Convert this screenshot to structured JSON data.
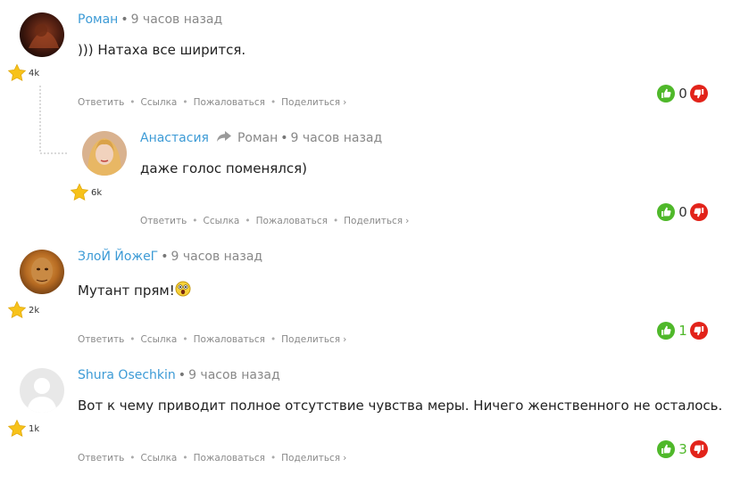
{
  "colors": {
    "author": "#3d9bd6",
    "up": "#4fb82a",
    "down": "#e2231a",
    "star": "#f7c21a"
  },
  "icons": {
    "rating": "star-icon",
    "reply": "reply-arrow-icon",
    "up": "thumbs-up-icon",
    "down": "thumbs-down-icon",
    "emoji": "scared-smiley-icon"
  },
  "action_labels": {
    "reply": "Ответить",
    "link": "Ссылка",
    "report": "Пожаловаться",
    "share": "Поделиться",
    "share_chevron": "›"
  },
  "separator": "•",
  "comments": [
    {
      "author": "Роман",
      "time": "9 часов назад",
      "text": "))) Натаха все ширится.",
      "rating": "4k",
      "votes": "0"
    },
    {
      "author": "Анастасия",
      "reply_to": "Роман",
      "time": "9 часов назад",
      "text": "даже голос поменялся)",
      "rating": "6k",
      "votes": "0"
    },
    {
      "author": "ЗлоЙ ЙожеГ",
      "time": "9 часов назад",
      "text": "Мутант прям!",
      "rating": "2k",
      "votes": "1"
    },
    {
      "author": "Shura Osechkin",
      "time": "9 часов назад",
      "text": "Вот к чему приводит полное отсутствие чувства меры. Ничего женственного не осталось.",
      "rating": "1k",
      "votes": "3"
    }
  ]
}
